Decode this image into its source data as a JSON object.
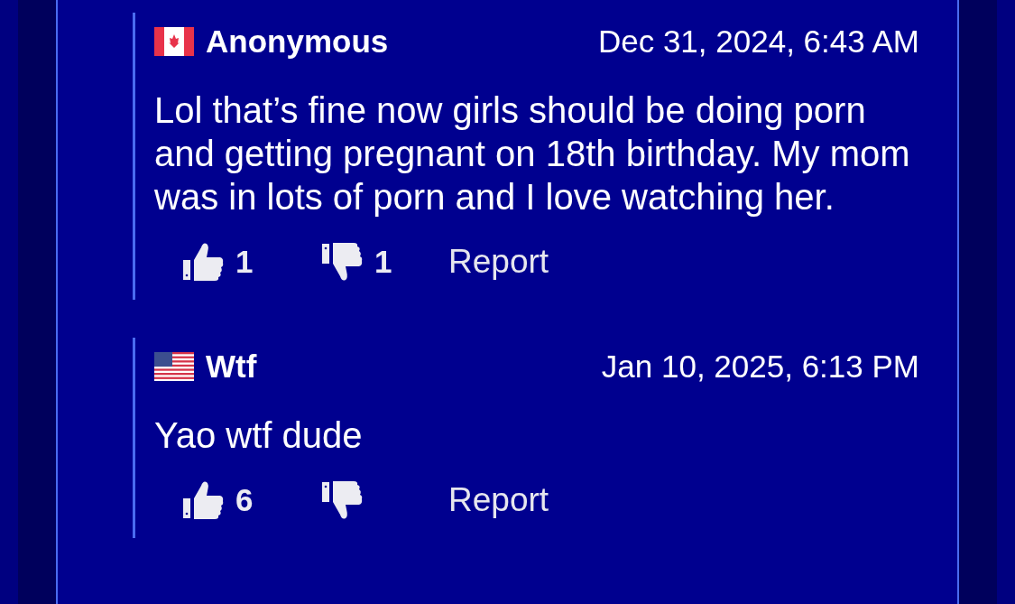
{
  "comments": [
    {
      "author": "Anonymous",
      "kind": "canada",
      "time": "Dec 31, 2024, 6:43 AM",
      "text": "Lol that’s fine now girls should be doing porn and getting pregnant on 18th birthday. My mom was in lots of porn and I love watching her.",
      "likes": "1",
      "dislikes": "1",
      "report": "Report"
    },
    {
      "author": "Wtf",
      "kind": "usa",
      "time": "Jan 10, 2025, 6:13 PM",
      "text": "Yao wtf dude",
      "likes": "6",
      "report": "Report"
    }
  ]
}
